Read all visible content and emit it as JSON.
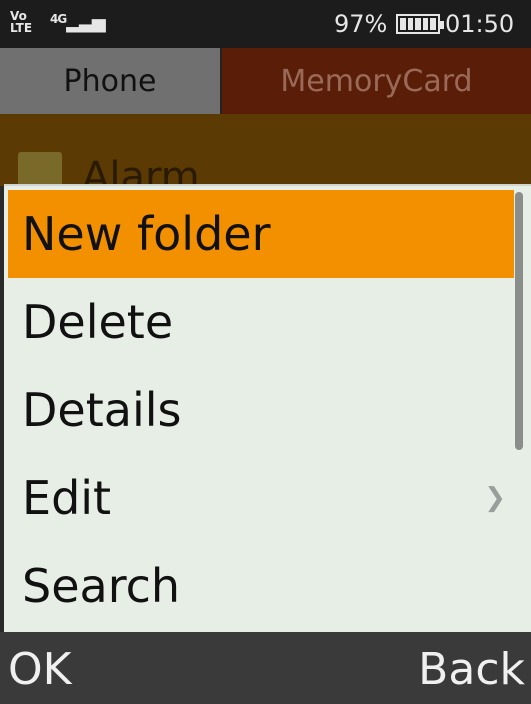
{
  "status": {
    "volte": [
      "Vo",
      "LTE"
    ],
    "network": "4G",
    "battery_percent": "97%",
    "battery_level": 1.0,
    "time": "01:50"
  },
  "tabs": [
    {
      "label": "Phone",
      "selected": false
    },
    {
      "label": "MemoryCard",
      "selected": true
    }
  ],
  "background_list": {
    "first_item": "Alarm"
  },
  "menu": {
    "items": [
      {
        "label": "New folder",
        "selected": true,
        "has_submenu": false
      },
      {
        "label": "Delete",
        "selected": false,
        "has_submenu": false
      },
      {
        "label": "Details",
        "selected": false,
        "has_submenu": false
      },
      {
        "label": "Edit",
        "selected": false,
        "has_submenu": true
      },
      {
        "label": "Search",
        "selected": false,
        "has_submenu": false
      }
    ]
  },
  "softkeys": {
    "left": "OK",
    "right": "Back"
  },
  "colors": {
    "highlight": "#f29000",
    "menu_bg": "#e7eee6",
    "tab_selected_bg": "#5a1e08"
  }
}
